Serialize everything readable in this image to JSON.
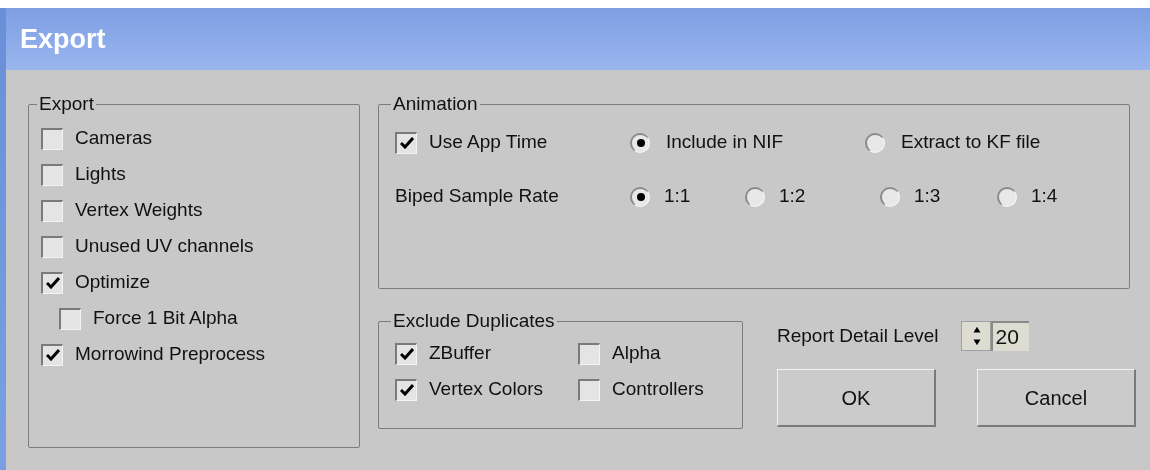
{
  "window": {
    "title": "Export"
  },
  "export_group": {
    "title": "Export",
    "options": [
      {
        "label": "Cameras",
        "checked": false
      },
      {
        "label": "Lights",
        "checked": false
      },
      {
        "label": "Vertex Weights",
        "checked": false
      },
      {
        "label": "Unused UV channels",
        "checked": false
      },
      {
        "label": "Optimize",
        "checked": true,
        "children": [
          {
            "label": "Force 1 Bit Alpha",
            "checked": false
          }
        ]
      },
      {
        "label": "Morrowind Preprocess",
        "checked": true
      }
    ]
  },
  "animation": {
    "title": "Animation",
    "use_app_time": {
      "label": "Use App Time",
      "checked": true
    },
    "destination": [
      {
        "label": "Include in NIF",
        "selected": true
      },
      {
        "label": "Extract to KF file",
        "selected": false
      }
    ],
    "sample_rate": {
      "label": "Biped Sample Rate",
      "options": [
        {
          "label": "1:1",
          "selected": true
        },
        {
          "label": "1:2",
          "selected": false
        },
        {
          "label": "1:3",
          "selected": false
        },
        {
          "label": "1:4",
          "selected": false
        }
      ]
    }
  },
  "exclude_duplicates": {
    "title": "Exclude Duplicates",
    "options": [
      {
        "label": "ZBuffer",
        "checked": true
      },
      {
        "label": "Alpha",
        "checked": false
      },
      {
        "label": "Vertex Colors",
        "checked": true
      },
      {
        "label": "Controllers",
        "checked": false
      }
    ]
  },
  "report_detail": {
    "label": "Report Detail Level",
    "value": "20"
  },
  "buttons": [
    "OK",
    "Cancel"
  ]
}
